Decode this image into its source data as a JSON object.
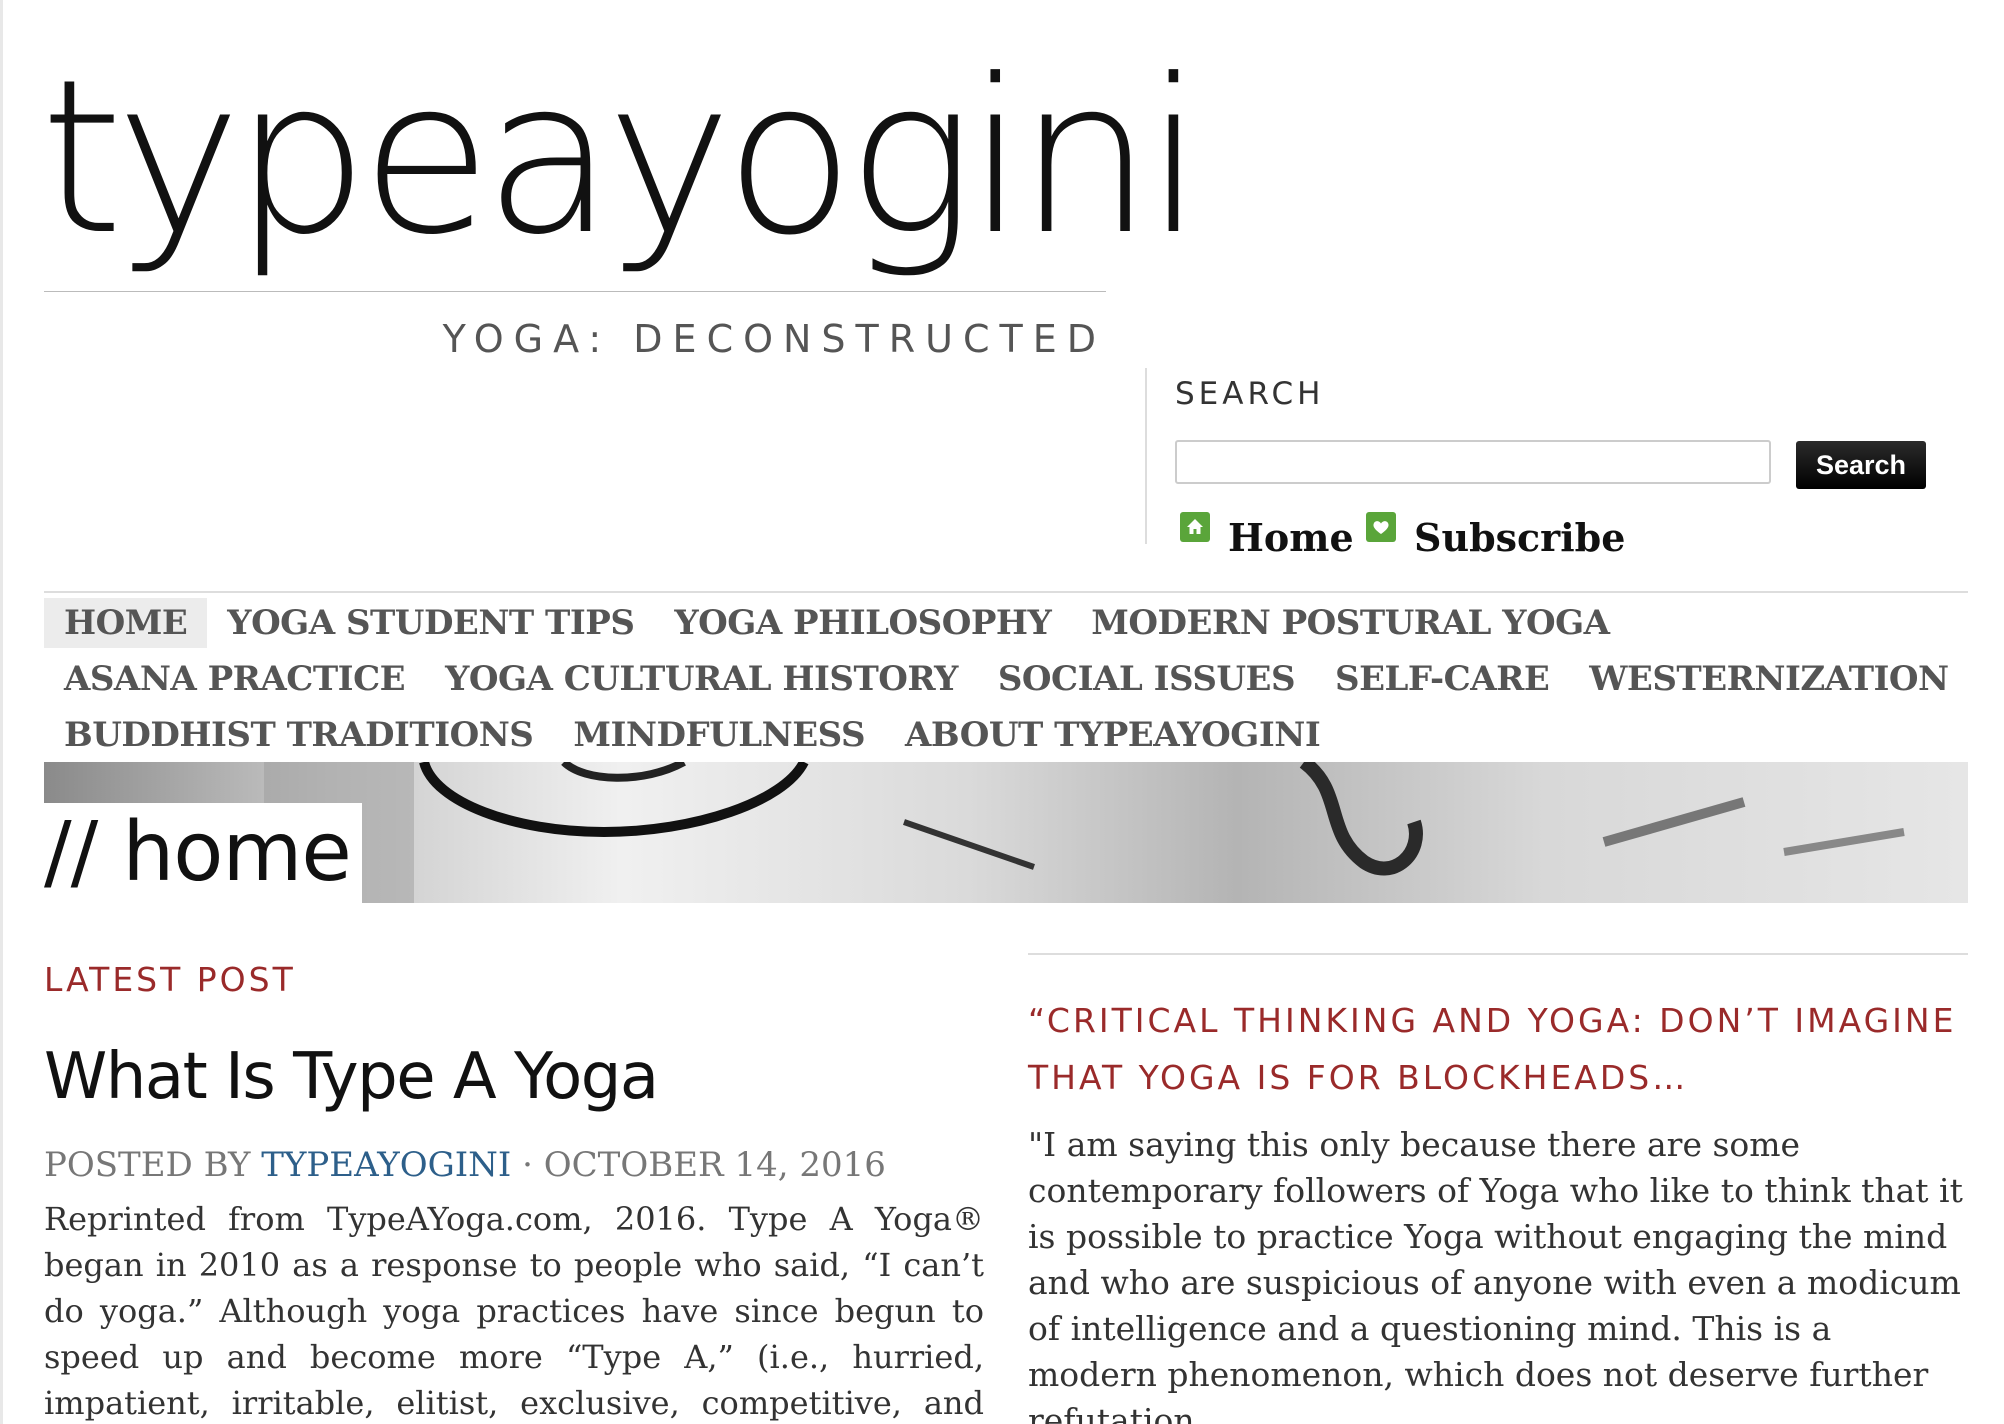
{
  "site": {
    "logo": "typeayogini",
    "tagline": "YOGA: DECONSTRUCTED"
  },
  "search": {
    "title": "SEARCH",
    "input_value": "",
    "button_label": "Search"
  },
  "quick_links": [
    {
      "label": "Home",
      "icon": "home-icon"
    },
    {
      "label": "Subscribe",
      "icon": "heart-icon"
    }
  ],
  "nav": {
    "rows": [
      [
        "HOME",
        "YOGA STUDENT TIPS",
        "YOGA PHILOSOPHY",
        "MODERN POSTURAL YOGA"
      ],
      [
        "ASANA PRACTICE",
        "YOGA CULTURAL HISTORY",
        "SOCIAL ISSUES",
        "SELF-CARE",
        "WESTERNIZATION"
      ],
      [
        "BUDDHIST TRADITIONS",
        "MINDFULNESS",
        "ABOUT TYPEAYOGINI"
      ]
    ],
    "active": "HOME"
  },
  "banner": {
    "title": "// home"
  },
  "latest": {
    "label": "LATEST POST",
    "title": "What Is Type A Yoga",
    "posted_by": "POSTED BY",
    "author": "TYPEAYOGINI",
    "separator": "·",
    "date": "OCTOBER 14, 2016",
    "excerpt": "Reprinted from TypeAYoga.com, 2016. Type A Yoga® began in 2010 as a response to people who said, “I can’t do yoga.” Although yoga practices have since begun to speed up and become more “Type A,” (i.e., hurried, impatient, irritable, elitist, exclusive, competitive, and stressful), our"
  },
  "quote": {
    "title": "“CRITICAL THINKING AND YOGA: DON’T IMAGINE THAT YOGA IS FOR BLOCKHEADS…",
    "body": "\"I am saying this only because there are some contemporary followers of Yoga who like to think that it is possible to practice Yoga without engaging the mind and who are suspicious of anyone with even a modicum of intelligence and a questioning mind. This is a modern phenomenon, which does not deserve further refutation."
  },
  "colors": {
    "accent_red": "#9a2a2a",
    "link_blue": "#2d5f8a",
    "icon_green": "#5aa53a"
  }
}
